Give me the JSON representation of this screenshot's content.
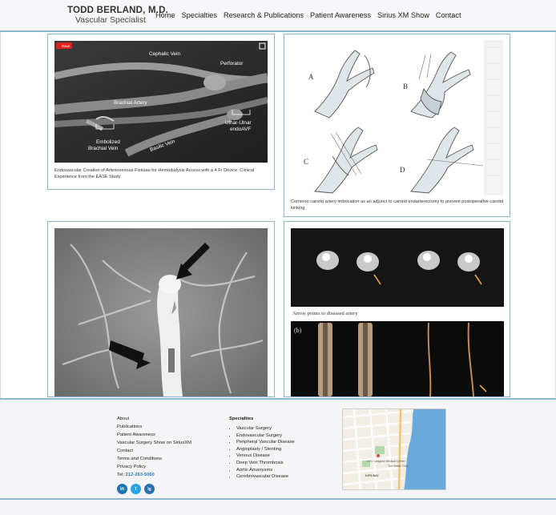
{
  "header": {
    "brand_name": "TODD BERLAND, M.D.",
    "brand_sub": "Vascular Specialist",
    "nav": [
      "Home",
      "Specialties",
      "Research & Publications",
      "Patient Awareness",
      "Sirius XM Show",
      "Contact"
    ]
  },
  "cards": {
    "c1": {
      "save_label": "Save",
      "labels": {
        "cephalic": "Cephalic Vein",
        "perforator": "Perforator",
        "brachial_artery": "Brachial Artery",
        "ulnar": "Ulnar-Ulnar",
        "endo": "endoAVF",
        "embolized": "Embolized",
        "brachial_vein": "Brachial Vein",
        "basilic": "Basilic Vein"
      },
      "caption": "Endovascular Creation of Arteriovenous Fistulae for Hemodialysis Access with a 4 Fr Device: Clinical Experience from the EASE Study"
    },
    "c2": {
      "panels": [
        "A",
        "B",
        "C",
        "D"
      ],
      "caption": "Common carotid artery imbrication as an adjunct to carotid endarterectomy to prevent postoperative carotid kinking"
    },
    "c4": {
      "top_caption": "Arrow points to diseased artery",
      "panel_b": "(b)"
    }
  },
  "footer": {
    "links": [
      "About",
      "Publications",
      "Patient Awareness",
      "Vascular Surgery Show on SiriusXM",
      "Contact",
      "Terms and Conditions",
      "Privacy Policy"
    ],
    "tel_label": "Tel:",
    "tel_number": "212-263-5060",
    "specialties_title": "Specialties",
    "specialties": [
      "Vascular Surgery",
      "Endovascular Surgery",
      "Peripheral Vascular Disease",
      "Angioplasty / Stenting",
      "Venous Disease",
      "Deep Vein Thrombosis",
      "Aortic Anuerysms",
      "Cerebrovascular Disease"
    ],
    "social": [
      "in",
      "t",
      "ig"
    ],
    "map": {
      "medical_center": "NYU Langone Medical Center",
      "area": "KIPS BAY",
      "street": "The Water Club"
    }
  },
  "colors": {
    "accent_border": "#8db6cf",
    "linkedin": "#1a74b5",
    "twitter": "#2aa3e6",
    "instagram": "#2a6fb0",
    "map_water": "#6aa9dc",
    "save_red": "#e0211d"
  }
}
